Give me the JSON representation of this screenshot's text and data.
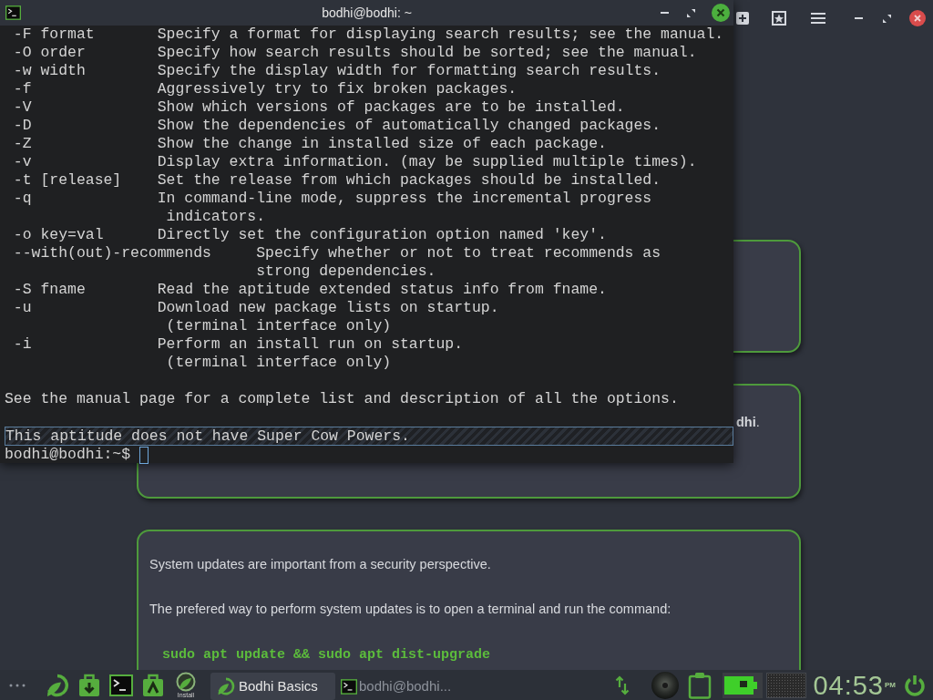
{
  "terminal": {
    "title": "bodhi@bodhi: ~",
    "options": [
      {
        "kind": "normal",
        "option": "-F format",
        "description": [
          "Specify a format for displaying search results; see the manual."
        ]
      },
      {
        "kind": "normal",
        "option": "-O order",
        "description": [
          "Specify how search results should be sorted; see the manual."
        ]
      },
      {
        "kind": "normal",
        "option": "-w width",
        "description": [
          "Specify the display width for formatting search results."
        ]
      },
      {
        "kind": "normal",
        "option": "-f",
        "description": [
          "Aggressively try to fix broken packages."
        ]
      },
      {
        "kind": "normal",
        "option": "-V",
        "description": [
          "Show which versions of packages are to be installed."
        ]
      },
      {
        "kind": "normal",
        "option": "-D",
        "description": [
          "Show the dependencies of automatically changed packages."
        ]
      },
      {
        "kind": "normal",
        "option": "-Z",
        "description": [
          "Show the change in installed size of each package."
        ]
      },
      {
        "kind": "normal",
        "option": "-v",
        "description": [
          "Display extra information. (may be supplied multiple times)."
        ]
      },
      {
        "kind": "normal",
        "option": "-t [release]",
        "description": [
          "Set the release from which packages should be installed."
        ]
      },
      {
        "kind": "normal",
        "option": "-q",
        "description": [
          "In command-line mode, suppress the incremental progress",
          "indicators."
        ]
      },
      {
        "kind": "normal",
        "option": "-o key=val",
        "description": [
          "Directly set the configuration option named 'key'."
        ]
      },
      {
        "kind": "wide",
        "option": "--with(out)-recommends",
        "description": [
          "Specify whether or not to treat recommends as",
          "strong dependencies."
        ]
      },
      {
        "kind": "normal",
        "option": "-S fname",
        "description": [
          "Read the aptitude extended status info from fname."
        ]
      },
      {
        "kind": "normal",
        "option": "-u",
        "description": [
          "Download new package lists on startup.",
          "(terminal interface only)"
        ]
      },
      {
        "kind": "normal",
        "option": "-i",
        "description": [
          "Perform an install run on startup.",
          "(terminal interface only)"
        ]
      }
    ],
    "footer": "See the manual page for a complete list and description of all the options.",
    "notice": {
      "text": "This aptitude does not have Super Cow Powers.",
      "highlighted": true
    },
    "prompt": "bodhi@bodhi:~$"
  },
  "cards": [
    {
      "kind": "blank"
    },
    {
      "kind": "fragment",
      "text": "**dhi**."
    },
    {
      "kind": "text",
      "paragraphs": [
        "System updates are important from a security perspective.",
        "The prefered way to perform system updates is to open a terminal and run the command:"
      ],
      "command": "sudo apt update && sudo apt dist-upgrade"
    }
  ],
  "taskbar": {
    "launchers": [
      {
        "kind": "leaf"
      },
      {
        "kind": "bag-down"
      },
      {
        "kind": "terminal"
      },
      {
        "kind": "bag-up"
      },
      {
        "kind": "install",
        "label": "Install"
      }
    ],
    "tasks": [
      {
        "kind": "leaf",
        "title": "Bodhi Basics",
        "selected": true
      },
      {
        "kind": "terminal",
        "title": "bodhi@bodhi...",
        "selected": false
      }
    ],
    "clock": {
      "time": "04:53",
      "period": "PM"
    }
  }
}
